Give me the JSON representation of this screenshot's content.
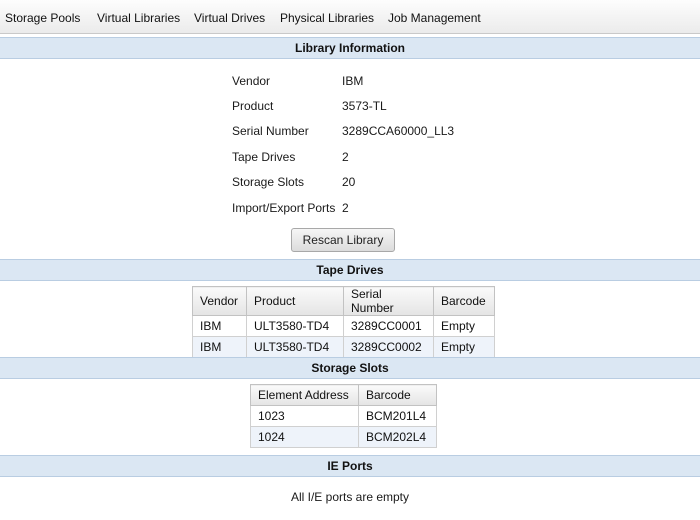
{
  "menu": [
    "Storage Pools",
    "Virtual Libraries",
    "Virtual Drives",
    "Physical Libraries",
    "Job Management"
  ],
  "library_info": {
    "title": "Library Information",
    "rows": [
      {
        "label": "Vendor",
        "value": "IBM"
      },
      {
        "label": "Product",
        "value": "3573-TL"
      },
      {
        "label": "Serial Number",
        "value": "3289CCA60000_LL3"
      },
      {
        "label": "Tape Drives",
        "value": "2"
      },
      {
        "label": "Storage Slots",
        "value": "20"
      },
      {
        "label": "Import/Export Ports",
        "value": "2"
      }
    ],
    "rescan_label": "Rescan Library"
  },
  "tape_drives": {
    "title": "Tape Drives",
    "columns": [
      "Vendor",
      "Product",
      "Serial Number",
      "Barcode"
    ],
    "rows": [
      [
        "IBM",
        "ULT3580-TD4",
        "3289CC0001",
        "Empty"
      ],
      [
        "IBM",
        "ULT3580-TD4",
        "3289CC0002",
        "Empty"
      ]
    ]
  },
  "storage_slots": {
    "title": "Storage Slots",
    "columns": [
      "Element Address",
      "Barcode"
    ],
    "rows": [
      [
        "1023",
        "BCM201L4"
      ],
      [
        "1024",
        "BCM202L4"
      ]
    ]
  },
  "ie_ports": {
    "title": "IE Ports",
    "message": "All I/E ports are empty"
  }
}
